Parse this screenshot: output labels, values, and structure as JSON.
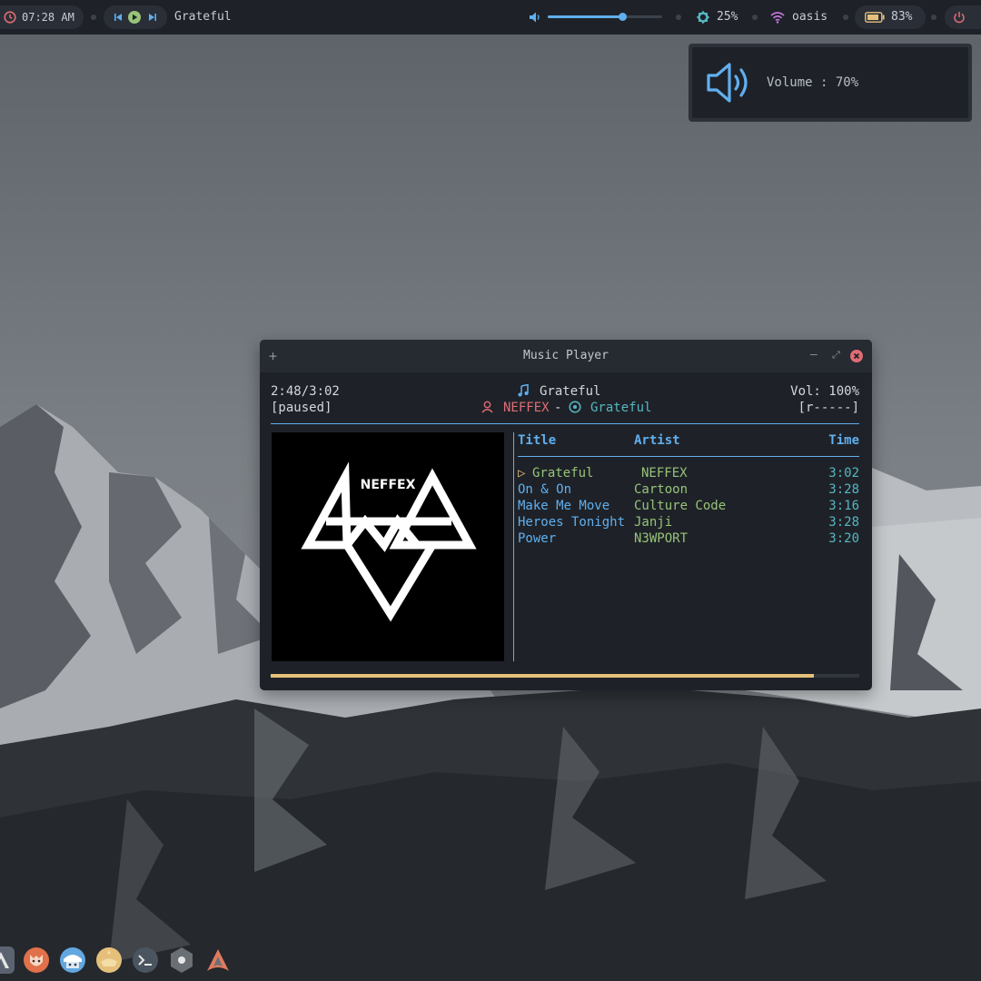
{
  "topbar": {
    "clock": "07:28 AM",
    "now_playing": "Grateful",
    "volume_level": 0.65,
    "brightness": "25%",
    "wifi": "oasis",
    "battery": "83%"
  },
  "osd": {
    "label": "Volume : 70%"
  },
  "player": {
    "window_title": "Music Player",
    "add_glyph": "+",
    "min_glyph": "–",
    "max_glyph": "⤢",
    "elapsed": "2:48/3:02",
    "state": "[paused]",
    "song_title": "Grateful",
    "artist": "NEFFEX",
    "separator": "-",
    "album": "Grateful",
    "volume": "Vol: 100%",
    "modes": "[r-----]",
    "album_art_text": "NEFFEX",
    "columns": {
      "title": "Title",
      "artist": "Artist",
      "time": "Time"
    },
    "playing_marker": "▷",
    "tracks": [
      {
        "title": "Grateful",
        "artist": "NEFFEX",
        "time": "3:02"
      },
      {
        "title": "On & On",
        "artist": "Cartoon",
        "time": "3:28"
      },
      {
        "title": "Make Me Move",
        "artist": "Culture Code",
        "time": "3:16"
      },
      {
        "title": "Heroes Tonight",
        "artist": "Janji",
        "time": "3:28"
      },
      {
        "title": "Power",
        "artist": "N3WPORT",
        "time": "3:20"
      }
    ],
    "progress": 0.923
  },
  "dock": {
    "icons": [
      "arch-launcher-icon",
      "firefox-icon",
      "file-manager-icon",
      "music-genie-icon",
      "terminal-icon",
      "settings-icon",
      "arch-linux-icon"
    ]
  },
  "colors": {
    "bar_bg": "#1e2228",
    "accent_blue": "#61afef",
    "green": "#98c379",
    "red": "#e06c75",
    "cyan": "#56b6c2",
    "progress": "#e5c07b"
  }
}
